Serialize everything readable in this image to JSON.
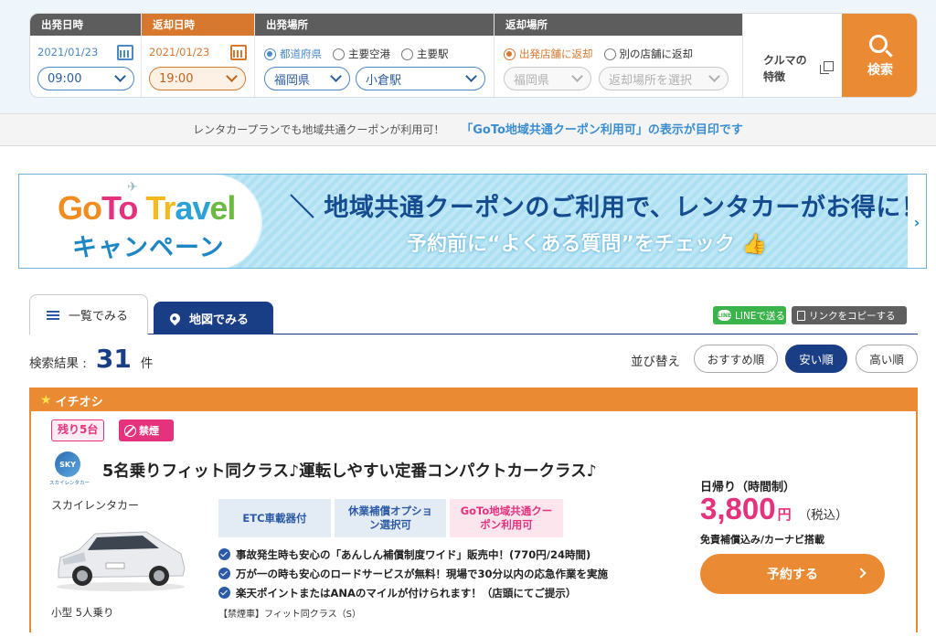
{
  "search": {
    "departure": {
      "header": "出発日時",
      "date": "2021/01/23",
      "time": "09:00"
    },
    "return": {
      "header": "返却日時",
      "date": "2021/01/23",
      "time": "19:00"
    },
    "pickup": {
      "header": "出発場所",
      "options": [
        "都道府県",
        "主要空港",
        "主要駅"
      ],
      "prefecture": "福岡県",
      "station": "小倉駅"
    },
    "dropoff": {
      "header": "返却場所",
      "options": [
        "出発店舗に返却",
        "別の店舗に返却"
      ],
      "prefecture": "福岡県",
      "location_placeholder": "返却場所を選択"
    },
    "feature_label_1": "クルマの",
    "feature_label_2": "特徴",
    "search_button": "検索"
  },
  "notice": {
    "text": "レンタカープランでも地域共通クーポンが利用可！",
    "highlight": "「GoTo地域共通クーポン利用可」の表示が目印です"
  },
  "banner": {
    "logo_parts": [
      "Go",
      "To",
      " Tr",
      "av",
      "el"
    ],
    "logo_campaign": "キャンペーン",
    "headline": "＼ 地域共通クーポンのご利用で、レンタカーがお得に！ ／",
    "subline": "予約前に“よくある質問”をチェック 👍",
    "arrow": "›"
  },
  "tabs": {
    "list": "一覧でみる",
    "map": "地図でみる"
  },
  "share": {
    "line_icon": "LINE",
    "line": "LINEで送る",
    "copy": "リンクをコピーする"
  },
  "results": {
    "label": "検索結果 :",
    "count": "31",
    "unit": "件",
    "sort_label": "並び替え",
    "sort_options": [
      "おすすめ順",
      "安い順",
      "高い順"
    ],
    "sort_selected": "安い順"
  },
  "card": {
    "header": "イチオシ",
    "remaining": "残り5台",
    "smoking": "禁煙",
    "logo_text": "SKY",
    "logo_sub": "スカイレンタカー",
    "title": "5名乗りフィット同クラス♪運転しやすい定番コンパクトカークラス♪",
    "company": "スカイレンタカー",
    "car_class": "小型 5人乗り",
    "tags": [
      "ETC車載器付",
      "休業補償オプション選択可",
      "GoTo地域共通クーポン利用可"
    ],
    "features": [
      "事故発生時も安心の「あんしん補償制度ワイド」販売中！(770円/24時間)",
      "万が一の時も安心のロードサービスが無料！現場で30分以内の応急作業を実施",
      "楽天ポイントまたはANAのマイルが付けられます！（店頭にてご提示）"
    ],
    "note": "【禁煙車】フィット同クラス（S）",
    "price_type": "日帰り（時間制）",
    "price": "3,800",
    "price_unit": "円",
    "price_tax": "（税込）",
    "price_note": "免責補償込み/カーナビ搭載",
    "reserve": "予約する"
  }
}
